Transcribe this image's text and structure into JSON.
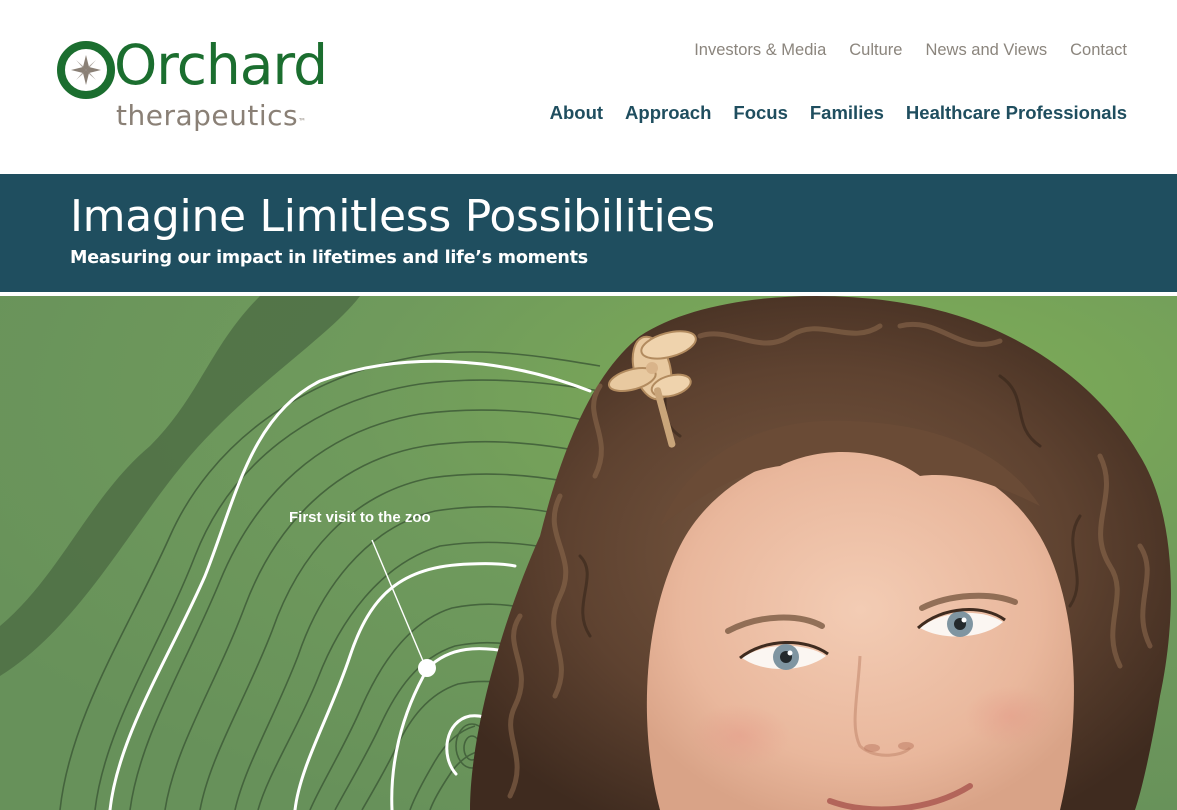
{
  "brand": {
    "name": "Orchard",
    "tagline": "therapeutics",
    "trademark": "™",
    "primary_color": "#1b6e2f",
    "secondary_color": "#8a8076",
    "icon": "star-seed-icon"
  },
  "utility_nav": [
    {
      "label": "Investors & Media"
    },
    {
      "label": "Culture"
    },
    {
      "label": "News and Views"
    },
    {
      "label": "Contact"
    }
  ],
  "main_nav": [
    {
      "label": "About"
    },
    {
      "label": "Approach"
    },
    {
      "label": "Focus"
    },
    {
      "label": "Families"
    },
    {
      "label": "Healthcare Professionals"
    }
  ],
  "banner": {
    "title": "Imagine Limitless Possibilities",
    "subtitle": "Measuring our impact in lifetimes and life’s moments",
    "background_color": "#1f4e5f"
  },
  "hero": {
    "caption": "First visit to the zoo",
    "background_color": "#6f9a5c",
    "image_subject": "smiling girl with curly brown hair and a gold hair clip"
  }
}
